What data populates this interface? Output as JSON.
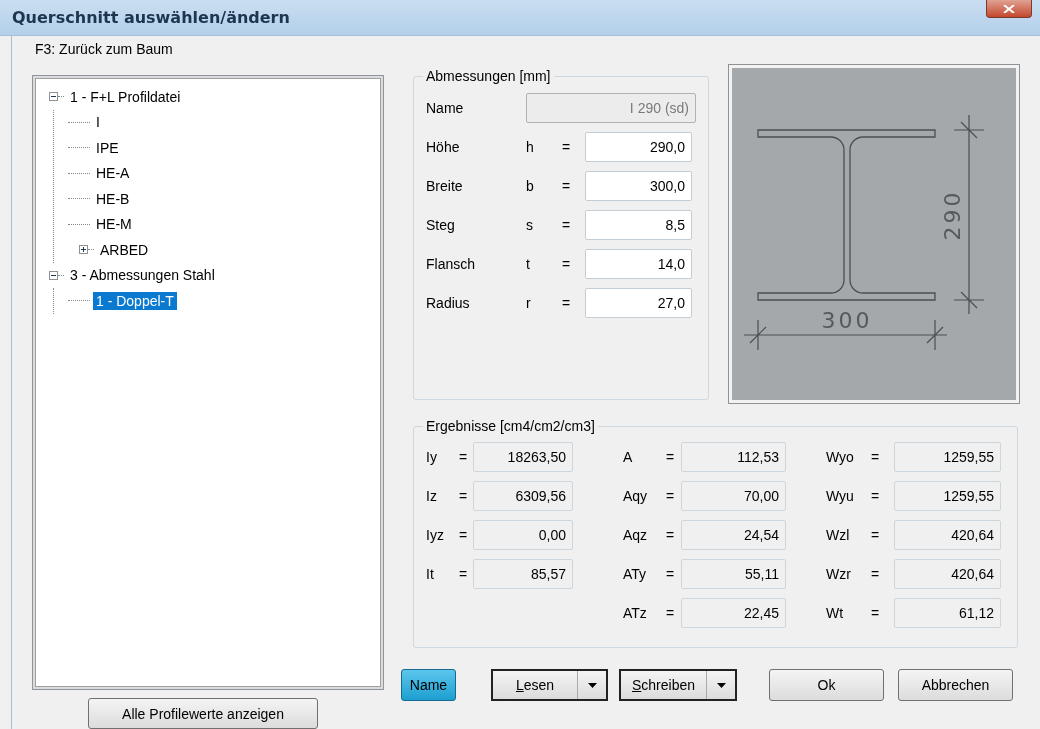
{
  "window": {
    "title": "Querschnitt auswählen/ändern"
  },
  "tree": {
    "label": "F3: Zurück zum Baum",
    "items": [
      {
        "label": "1 - F+L Profildatei",
        "expanded": true,
        "selected": false,
        "children": [
          {
            "label": "I",
            "selected": false
          },
          {
            "label": "IPE",
            "selected": false
          },
          {
            "label": "HE-A",
            "selected": false
          },
          {
            "label": "HE-B",
            "selected": false
          },
          {
            "label": "HE-M",
            "selected": false
          },
          {
            "label": "ARBED",
            "expanded": false,
            "selected": false
          }
        ]
      },
      {
        "label": "3 - Abmessungen Stahl",
        "expanded": true,
        "selected": false,
        "children": [
          {
            "label": "1 - Doppel-T",
            "selected": true
          }
        ]
      }
    ],
    "button": "Alle Profilewerte anzeigen"
  },
  "dimensions": {
    "title": "Abmessungen  [mm]",
    "name": {
      "label": "Name",
      "value": "I 290 (sd)",
      "disabled": true
    },
    "rows": [
      {
        "label": "Höhe",
        "symbol": "h",
        "equals": "=",
        "value": "290,0"
      },
      {
        "label": "Breite",
        "symbol": "b",
        "equals": "=",
        "value": "300,0"
      },
      {
        "label": "Steg",
        "symbol": "s",
        "equals": "=",
        "value": "8,5"
      },
      {
        "label": "Flansch",
        "symbol": "t",
        "equals": "=",
        "value": "14,0"
      },
      {
        "label": "Radius",
        "symbol": "r",
        "equals": "=",
        "value": "27,0"
      }
    ]
  },
  "drawing": {
    "height_label": "290",
    "width_label": "300"
  },
  "results": {
    "title": "Ergebnisse  [cm4/cm2/cm3]",
    "columns": [
      [
        {
          "symbol": "Iy",
          "equals": "=",
          "value": "18263,50"
        },
        {
          "symbol": "Iz",
          "equals": "=",
          "value": "6309,56"
        },
        {
          "symbol": "Iyz",
          "equals": "=",
          "value": "0,00"
        },
        {
          "symbol": "It",
          "equals": "=",
          "value": "85,57"
        }
      ],
      [
        {
          "symbol": "A",
          "equals": "=",
          "value": "112,53"
        },
        {
          "symbol": "Aqy",
          "equals": "=",
          "value": "70,00"
        },
        {
          "symbol": "Aqz",
          "equals": "=",
          "value": "24,54"
        },
        {
          "symbol": "ATy",
          "equals": "=",
          "value": "55,11"
        },
        {
          "symbol": "ATz",
          "equals": "=",
          "value": "22,45"
        }
      ],
      [
        {
          "symbol": "Wyo",
          "equals": "=",
          "value": "1259,55"
        },
        {
          "symbol": "Wyu",
          "equals": "=",
          "value": "1259,55"
        },
        {
          "symbol": "Wzl",
          "equals": "=",
          "value": "420,64"
        },
        {
          "symbol": "Wzr",
          "equals": "=",
          "value": "420,64"
        },
        {
          "symbol": "Wt",
          "equals": "=",
          "value": "61,12"
        }
      ]
    ]
  },
  "buttons": [
    {
      "label": "Name",
      "kind": "toggle",
      "pressed": true
    },
    {
      "label": "Lesen",
      "kind": "split",
      "mnemonic": true
    },
    {
      "label": "Schreiben",
      "kind": "split",
      "mnemonic": true
    },
    {
      "label": "Ok",
      "kind": "push"
    },
    {
      "label": "Abbrechen",
      "kind": "push"
    }
  ]
}
